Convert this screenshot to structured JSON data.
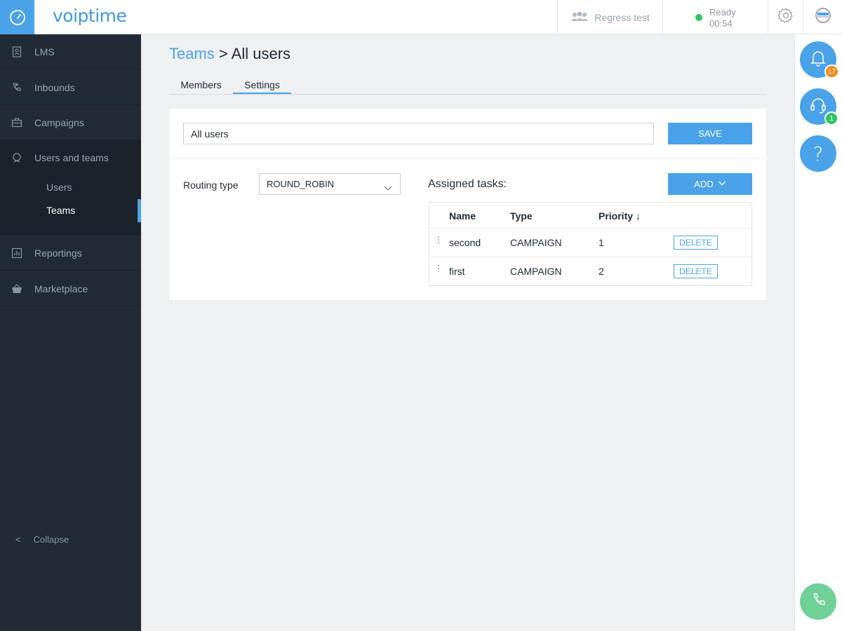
{
  "app": {
    "logo": "voiptime"
  },
  "topbar": {
    "team_name": "Regress test",
    "status_label": "Ready",
    "status_time": "00:54",
    "status_color": "#2ec45f"
  },
  "sidebar": {
    "items": [
      {
        "label": "LMS",
        "icon": "contacts-book-icon"
      },
      {
        "label": "Inbounds",
        "icon": "incoming-call-icon"
      },
      {
        "label": "Campaigns",
        "icon": "briefcase-icon"
      },
      {
        "label": "Users and teams",
        "icon": "user-head-icon"
      },
      {
        "label": "Reportings",
        "icon": "bar-chart-icon"
      },
      {
        "label": "Marketplace",
        "icon": "basket-icon"
      }
    ],
    "sub_items": [
      {
        "label": "Users",
        "active": false
      },
      {
        "label": "Teams",
        "active": true
      }
    ],
    "collapse_label": "Collapse",
    "collapse_icon": "<"
  },
  "breadcrumb": {
    "link": "Teams",
    "separator": " > ",
    "current": "All users"
  },
  "tabs": [
    {
      "label": "Members",
      "active": false
    },
    {
      "label": "Settings",
      "active": true
    }
  ],
  "settings": {
    "team_name_value": "All users",
    "save_label": "SAVE",
    "routing_label": "Routing type",
    "routing_value": "ROUND_ROBIN",
    "assigned_label": "Assigned tasks:",
    "add_label": "ADD"
  },
  "tasks_table": {
    "headers": {
      "name": "Name",
      "type": "Type",
      "priority": "Priority",
      "sort_indicator": "↓"
    },
    "rows": [
      {
        "name": "second",
        "type": "CAMPAIGN",
        "priority": "1",
        "action": "DELETE"
      },
      {
        "name": "first",
        "type": "CAMPAIGN",
        "priority": "2",
        "action": "DELETE"
      }
    ]
  },
  "rightrail": {
    "notifications_count": "17",
    "support_count": "1",
    "notifications_badge_color": "#f08a1c",
    "support_badge_color": "#2ec45f",
    "help_symbol": "?"
  },
  "colors": {
    "accent": "#4aa3e8",
    "sidebar_bg": "#222b35",
    "call_button": "#6fd198"
  }
}
